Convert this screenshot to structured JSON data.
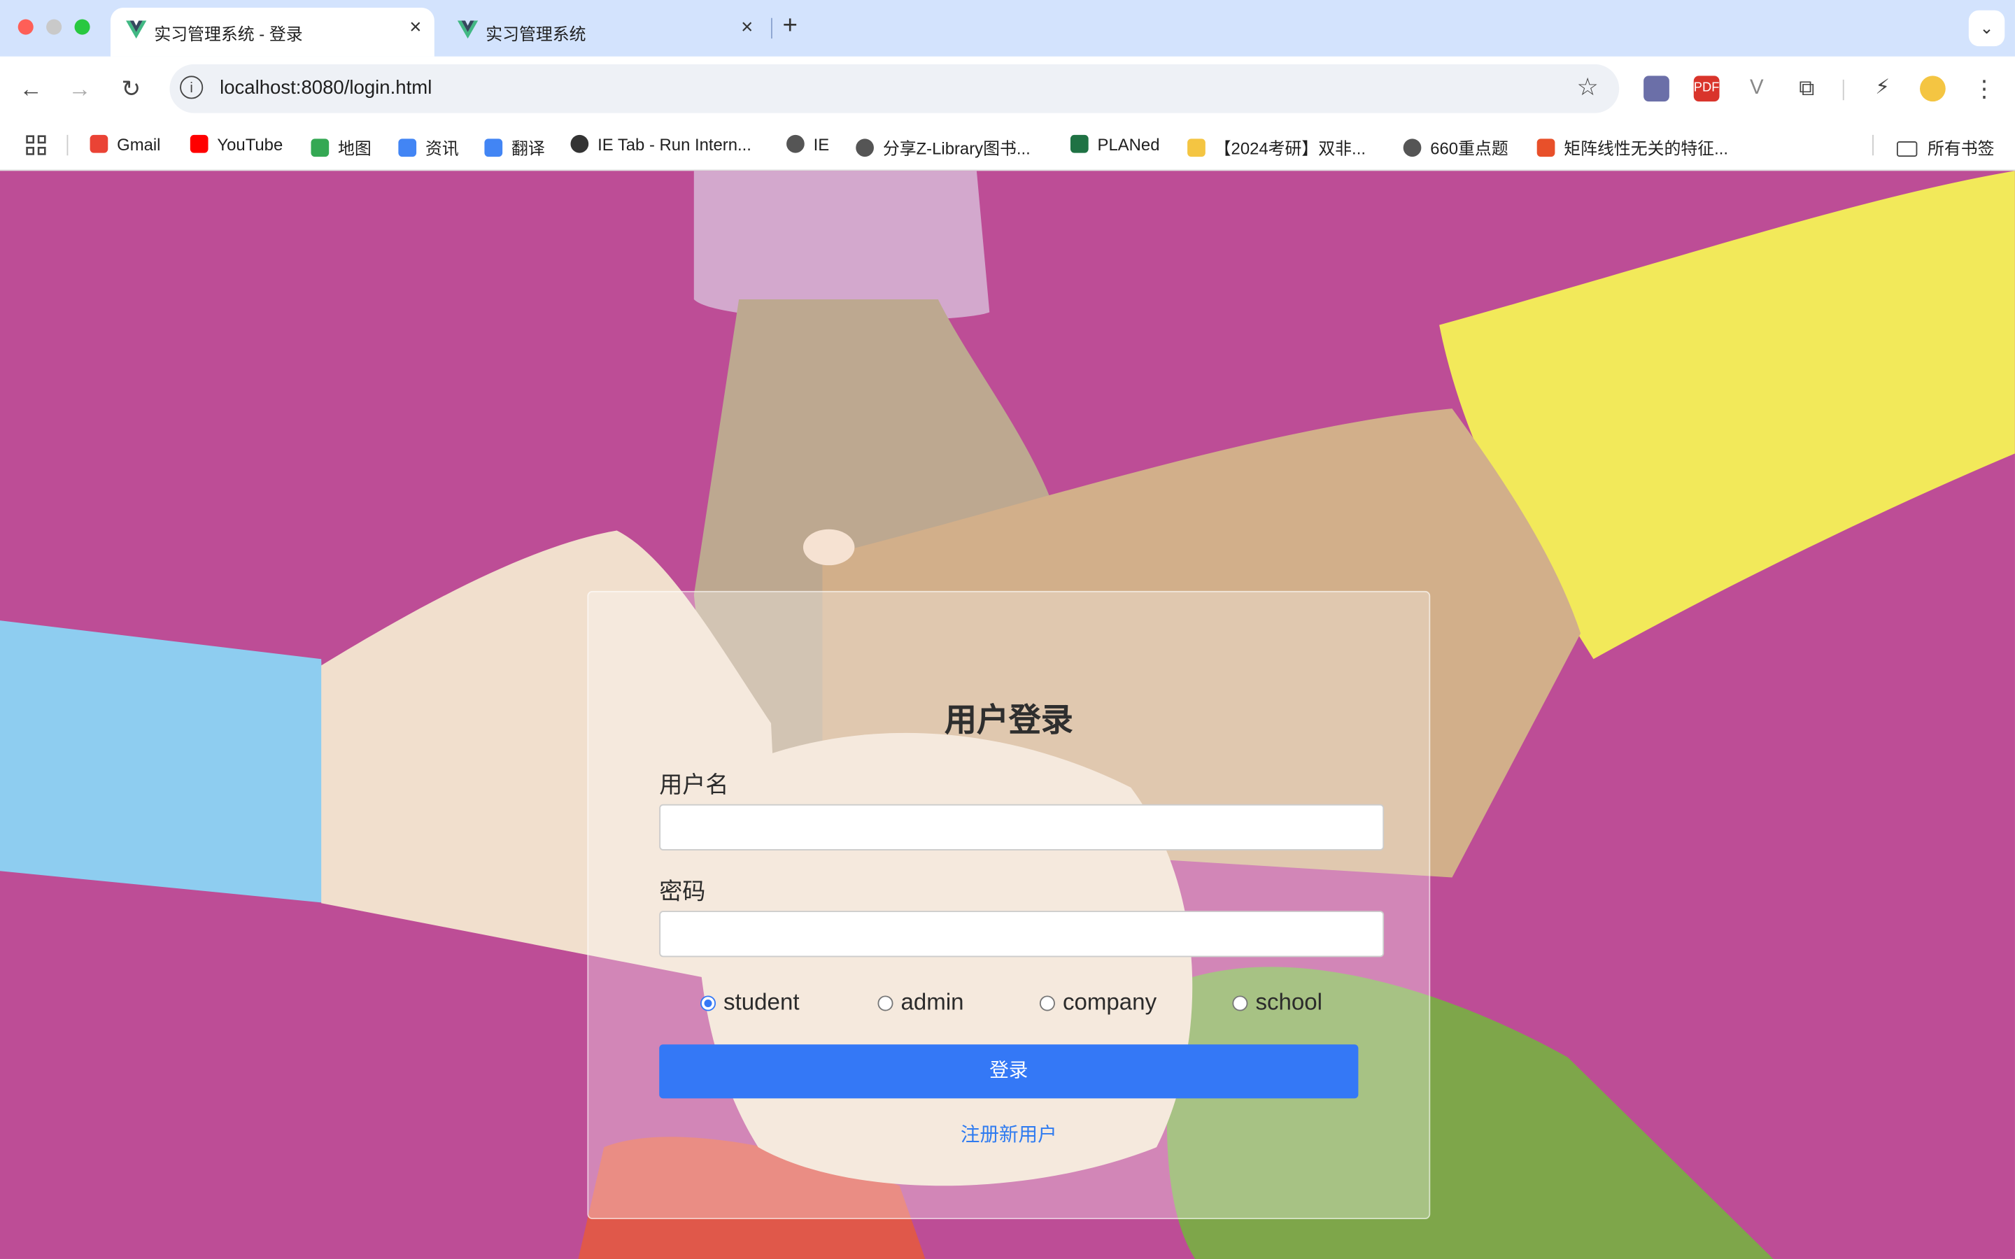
{
  "browser": {
    "tabs": [
      {
        "title": "实习管理系统 - 登录",
        "active": true
      },
      {
        "title": "实习管理系统",
        "active": false
      }
    ],
    "url": "localhost:8080/login.html",
    "new_tab_label": "+",
    "bookmarks": [
      {
        "label": "Gmail",
        "color": "#ea4335"
      },
      {
        "label": "YouTube",
        "color": "#ff0000"
      },
      {
        "label": "地图",
        "color": "#34a853"
      },
      {
        "label": "资讯",
        "color": "#4285f4"
      },
      {
        "label": "翻译",
        "color": "#4285f4"
      },
      {
        "label": "IE Tab - Run Intern...",
        "color": "#333333"
      },
      {
        "label": "IE",
        "color": "#555555"
      },
      {
        "label": "分享Z-Library图书...",
        "color": "#555555"
      },
      {
        "label": "PLANed",
        "color": "#1f7244"
      },
      {
        "label": "【2024考研】双非...",
        "color": "#f4c542"
      },
      {
        "label": "660重点题",
        "color": "#555555"
      },
      {
        "label": "矩阵线性无关的特征...",
        "color": "#e8502a"
      }
    ],
    "all_bookmarks_label": "所有书签"
  },
  "login": {
    "title": "用户登录",
    "username_label": "用户名",
    "username_value": "",
    "password_label": "密码",
    "password_value": "",
    "roles": [
      "student",
      "admin",
      "company",
      "school"
    ],
    "selected_role": "student",
    "submit_label": "登录",
    "register_link": "注册新用户"
  },
  "colors": {
    "page_background": "#bd4d96",
    "primary_button": "#3478f6",
    "link": "#2f7bf0"
  }
}
